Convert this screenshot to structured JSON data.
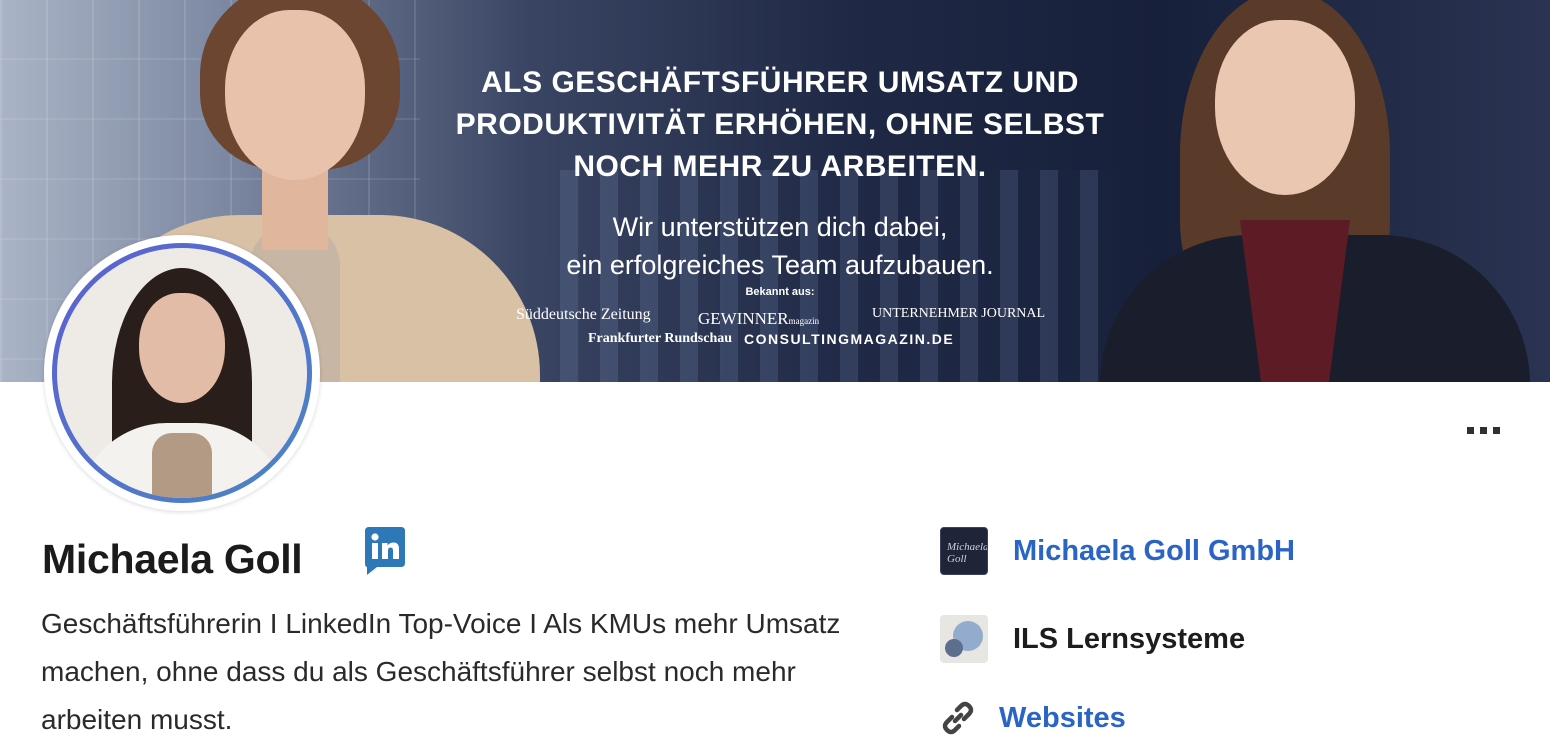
{
  "banner": {
    "headline_lines": [
      "ALS GESCHÄFTSFÜHRER UMSATZ UND",
      "PRODUKTIVITÄT ERHÖHEN, OHNE SELBST",
      "NOCH MEHR ZU ARBEITEN."
    ],
    "subline_lines": [
      "Wir unterstützen dich dabei,",
      "ein erfolgreiches Team aufzubauen."
    ],
    "known_from": "Bekannt aus:",
    "press_logos": {
      "sz": "Süddeutsche Zeitung",
      "gewinner": "GEWINNER",
      "gewinner_suffix": "magazin",
      "unternehmer": "UNTERNEHMER JOURNAL",
      "fr": "Frankfurter Rundschau",
      "consulting": "CONSULTINGMAGAZIN.DE"
    }
  },
  "profile": {
    "name": "Michaela Goll",
    "headline": "Geschäftsführerin I LinkedIn Top-Voice I Als KMUs mehr Umsatz machen, ohne dass du als Geschäftsführer selbst noch mehr arbeiten musst."
  },
  "organizations": [
    {
      "name": "Michaela Goll GmbH",
      "logo_text": "Michaela Goll"
    },
    {
      "name": "ILS Lernsysteme"
    }
  ],
  "websites_label": "Websites",
  "icons": {
    "linkedin": "linkedin-icon",
    "link": "link-icon",
    "more": "more-horizontal-icon"
  },
  "colors": {
    "link_blue": "#2a64c5",
    "linkedin_blue": "#2f78b7"
  }
}
